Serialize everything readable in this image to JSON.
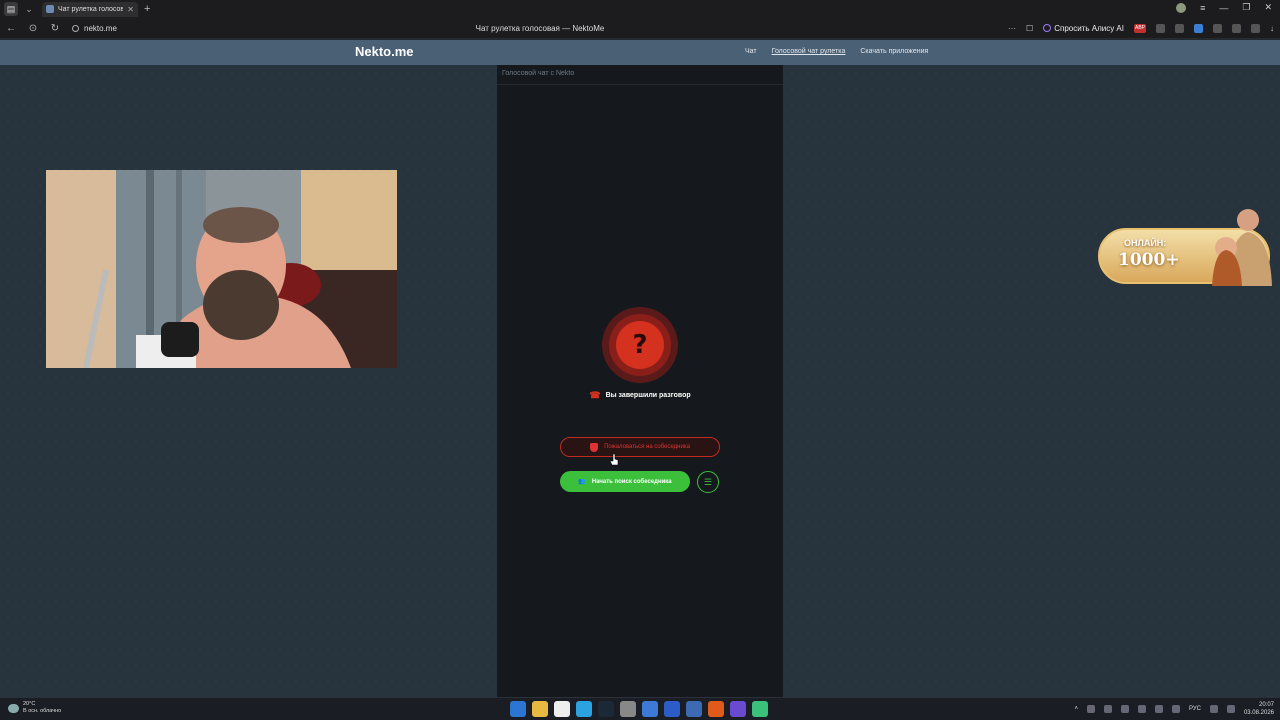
{
  "browser": {
    "tab_title": "Чат рулетка голосовая — NektoMe",
    "tab_title_short": "Чат рулетка голосова",
    "url": "nekto.me",
    "page_title": "Чат рулетка голосовая — NektoMe",
    "alice_label": "Спросить Алису AI",
    "abp_label": "ABP"
  },
  "site": {
    "logo": "Nekto.me",
    "nav": [
      {
        "label": "Чат"
      },
      {
        "label": "Голосовой чат рулетка"
      },
      {
        "label": "Скачать приложения"
      }
    ]
  },
  "panel": {
    "header": "Голосовой чат с Nekto",
    "status_icon": "question-mark",
    "status_text": "Вы завершили разговор",
    "complain_label": "Пожаловаться на собеседника",
    "search_label": "Начать поиск собеседника"
  },
  "online_badge": {
    "label": "ОНЛАЙН:",
    "count": "1000+"
  },
  "taskbar": {
    "temperature": "20°C",
    "weather": "В осн. облачно",
    "lang": "РУС",
    "time": "20:07",
    "date": "03.08.2026"
  },
  "colors": {
    "header": "#4a6075",
    "panel": "#15191d",
    "accent_red": "#d4321f",
    "accent_green": "#3cc03c"
  }
}
